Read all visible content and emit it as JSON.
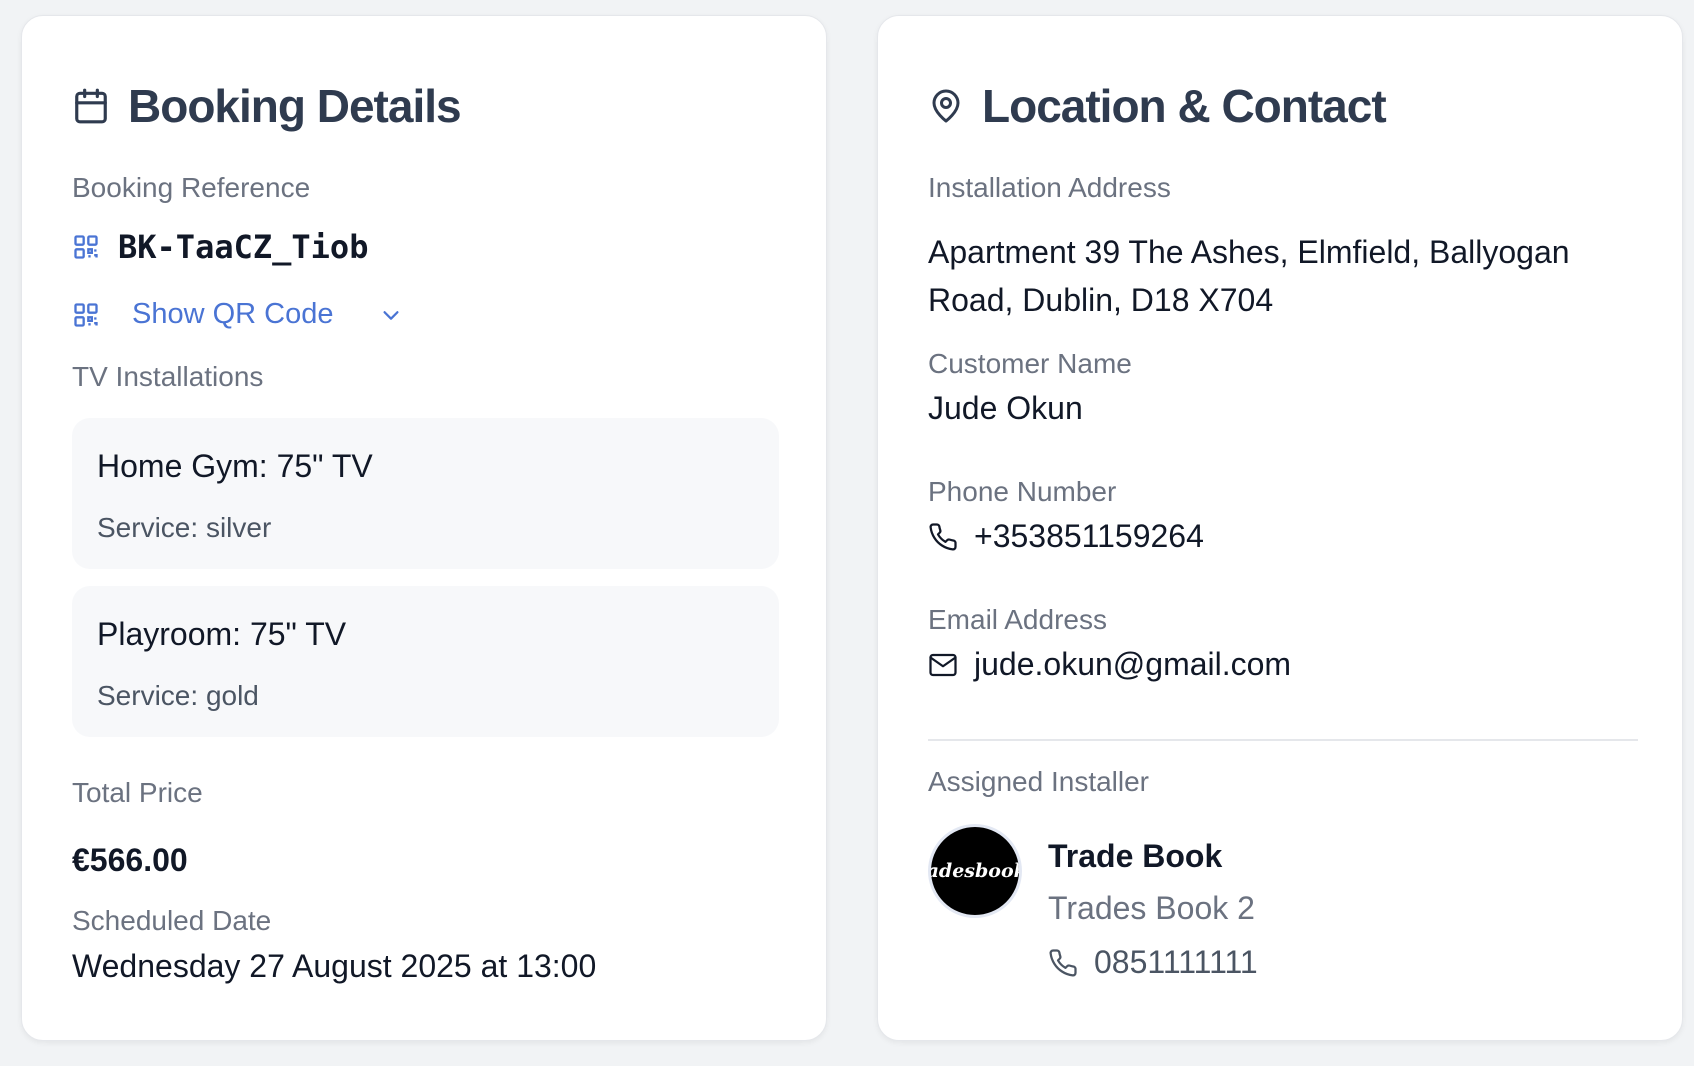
{
  "booking": {
    "title": "Booking Details",
    "title_icon": "calendar-icon",
    "reference_label": "Booking Reference",
    "reference_value": "BK-TaaCZ_Tiob",
    "qr_toggle_label": "Show QR Code",
    "tv_label": "TV Installations",
    "tv_items": [
      {
        "name": "Home Gym: 75\" TV",
        "service_prefix": "Service:",
        "service": "silver"
      },
      {
        "name": "Playroom: 75\" TV",
        "service_prefix": "Service:",
        "service": "gold"
      }
    ],
    "price_label": "Total Price",
    "price_value": "€566.00",
    "date_label": "Scheduled Date",
    "date_value": "Wednesday 27 August 2025 at 13:00"
  },
  "location": {
    "title": "Location & Contact",
    "title_icon": "map-pin-icon",
    "address_label": "Installation Address",
    "address_value": "Apartment 39 The Ashes, Elmfield, Ballyogan Road, Dublin, D18 X704",
    "customer_label": "Customer Name",
    "customer_value": "Jude Okun",
    "phone_label": "Phone Number",
    "phone_value": "+353851159264",
    "email_label": "Email Address",
    "email_value": "jude.okun@gmail.com",
    "installer_label": "Assigned Installer",
    "installer_name": "Trade Book",
    "installer_company": "Trades Book 2",
    "installer_phone": "0851111111",
    "installer_avatar_text": "radesbook."
  },
  "colors": {
    "accent": "#4a74d4",
    "title": "#2f3b4f",
    "muted": "#6b7280",
    "card_bg": "#ffffff",
    "page_bg": "#f1f3f5"
  }
}
